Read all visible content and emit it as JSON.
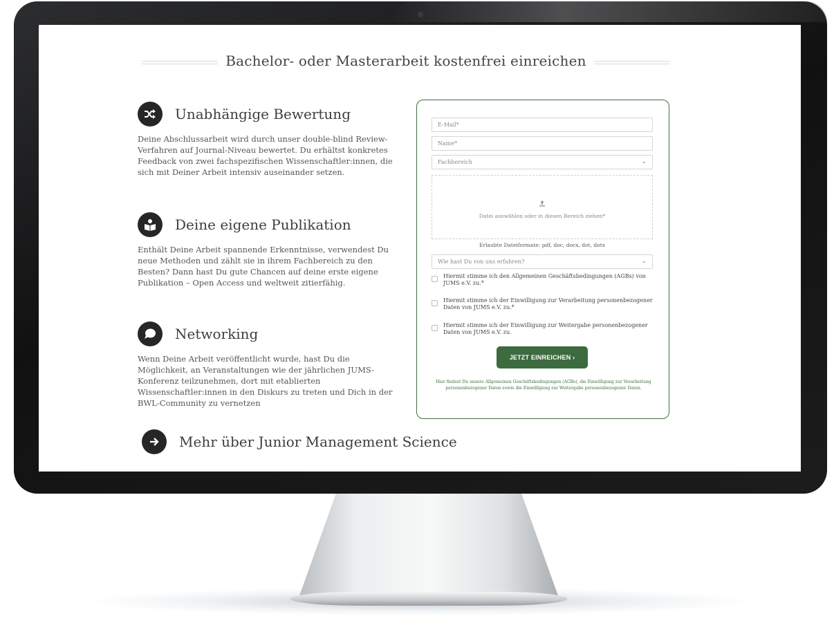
{
  "section_title": "Bachelor- oder Masterarbeit kostenfrei einreichen",
  "features": [
    {
      "icon": "shuffle-icon",
      "title": "Unabhängige Bewertung",
      "text": "Deine Abschlussarbeit wird durch unser double-blind Review-Verfahren auf Journal-Niveau bewertet. Du erhältst konkretes Feedback von zwei fachspezifischen Wissenschaftler:innen, die sich mit Deiner Arbeit intensiv auseinander setzen."
    },
    {
      "icon": "reader-book-icon",
      "title": "Deine eigene Publikation",
      "text": "Enthält Deine Arbeit spannende Erkenntnisse, verwendest Du neue Methoden und zählt sie in ihrem Fachbereich zu den Besten? Dann hast Du gute Chancen auf deine erste eigene Publikation – Open Access und weltweit zitierfähig."
    },
    {
      "icon": "speech-bubble-icon",
      "title": "Networking",
      "text": "Wenn Deine Arbeit veröffentlicht wurde, hast Du die Möglichkeit, an Veranstaltungen wie der jährlichen JUMS-Konferenz teilzunehmen, dort mit etablierten Wissenschaftler:innen in den Diskurs zu treten und Dich in der BWL-Community zu vernetzen"
    }
  ],
  "more_link": "Mehr über Junior Management Science",
  "form": {
    "email_placeholder": "E-Mail*",
    "name_placeholder": "Name*",
    "fachbereich_placeholder": "Fachbereich",
    "upload_text": "Datei auswählen oder in diesen Bereich ziehen*",
    "formats_text": "Erlaubte Dateiformate: pdf, doc, docx, dot, dotx",
    "source_placeholder": "Wie hast Du von uns erfahren?",
    "checkboxes": [
      "Hiermit stimme ich den Allgemeinen Geschäftsbedingungen (AGBs) von JUMS e.V. zu.*",
      "Hiermit stimme ich der Einwilligung zur Verarbeitung personenbezogener Daten von JUMS e.V. zu.*",
      "Hiermit stimme ich der Einwilligung zur Weitergabe personenbezogener Daten von JUMS e.V. zu."
    ],
    "submit_label": "JETZT EINREICHEN  ›",
    "legal_text": "Hier findest Du unsere Allgemeinen Geschäftsbedingungen (AGBs), die Einwilligung zur Verarbeitung personenbezogener Daten sowie die Einwilligung zur Weitergabe personenbezogener Daten."
  },
  "colors": {
    "accent_green": "#3d6b3f",
    "icon_dark": "#262626",
    "monitor_bezel": "#111112"
  }
}
